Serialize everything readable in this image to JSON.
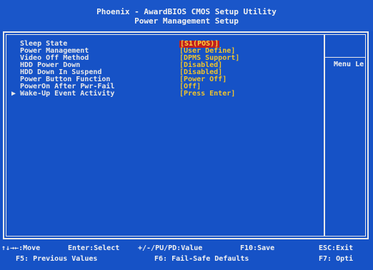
{
  "header": {
    "title": "Phoenix - AwardBIOS CMOS Setup Utility",
    "subtitle": "Power Management Setup"
  },
  "settings": [
    {
      "label": "Sleep State",
      "value": "[S1(POS)]",
      "selected": true,
      "submenu": false
    },
    {
      "label": "Power Management",
      "value": "[User Define]",
      "selected": false,
      "submenu": false
    },
    {
      "label": "Video Off Method",
      "value": "[DPMS Support]",
      "selected": false,
      "submenu": false
    },
    {
      "label": "HDD Power Down",
      "value": "[Disabled]",
      "selected": false,
      "submenu": false
    },
    {
      "label": "HDD Down In Suspend",
      "value": "[Disabled]",
      "selected": false,
      "submenu": false
    },
    {
      "label": "Power Button Function",
      "value": "[Power Off]",
      "selected": false,
      "submenu": false
    },
    {
      "label": "PowerOn After Pwr-Fail",
      "value": "[Off]",
      "selected": false,
      "submenu": false
    },
    {
      "label": "Wake-Up Event Activity",
      "value": "[Press Enter]",
      "selected": false,
      "submenu": true
    }
  ],
  "help": {
    "menu_level": "Menu Le"
  },
  "footer": {
    "row1": [
      "↑↓→←:Move",
      "Enter:Select",
      "+/-/PU/PD:Value",
      "F10:Save",
      "ESC:Exit"
    ],
    "row2": [
      "F5: Previous Values",
      "F6: Fail-Safe Defaults",
      "F7: Opti"
    ]
  },
  "colors": {
    "background": "#1652c6",
    "label": "#e9e9e9",
    "value": "#f0c42b",
    "selected_bg": "#c01f1f",
    "selected_text": "#ffd23a"
  }
}
